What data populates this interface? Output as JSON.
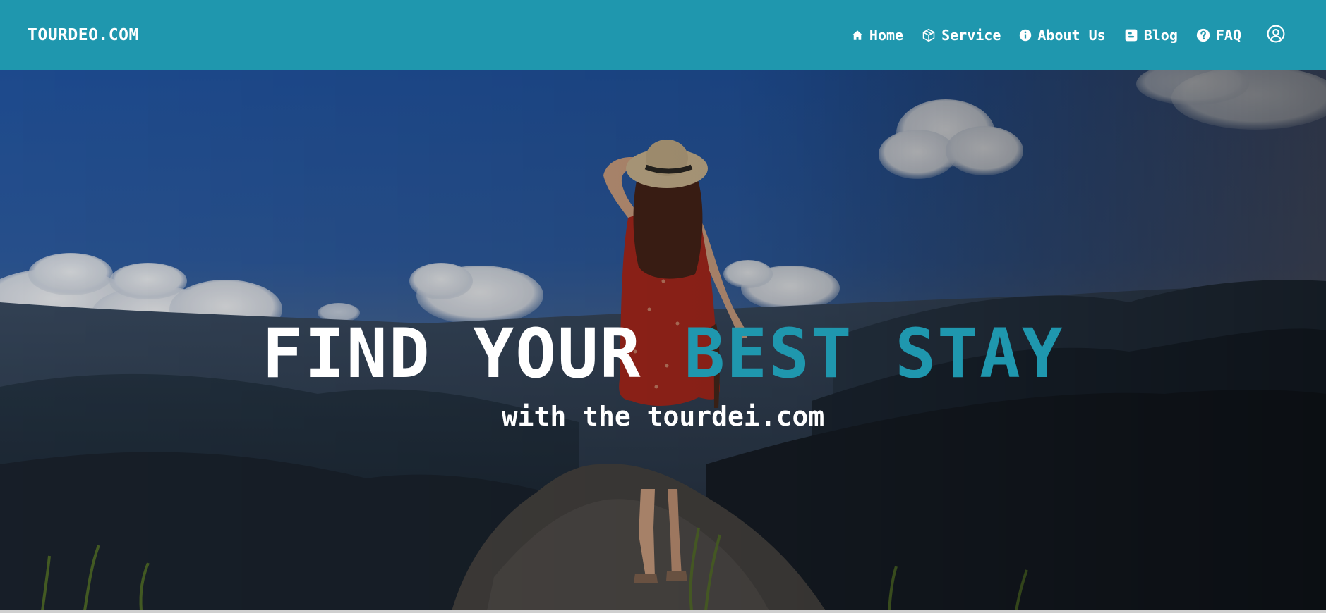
{
  "navbar": {
    "brand": "TOURDEO.COM",
    "background": "#1f97ae",
    "links": [
      {
        "label": "Home",
        "icon": "home-icon"
      },
      {
        "label": "Service",
        "icon": "box-icon"
      },
      {
        "label": "About Us",
        "icon": "info-icon"
      },
      {
        "label": "Blog",
        "icon": "blogger-icon"
      },
      {
        "label": "FAQ",
        "icon": "question-icon"
      }
    ],
    "profile_icon": "user-circle-icon"
  },
  "hero": {
    "headline_white": "FIND YOUR ",
    "headline_accent": "BEST STAY",
    "subline": "with the tourdei.com",
    "accent_color": "#1f97ae",
    "image": "woman-in-red-dress-on-mountain-peak"
  }
}
